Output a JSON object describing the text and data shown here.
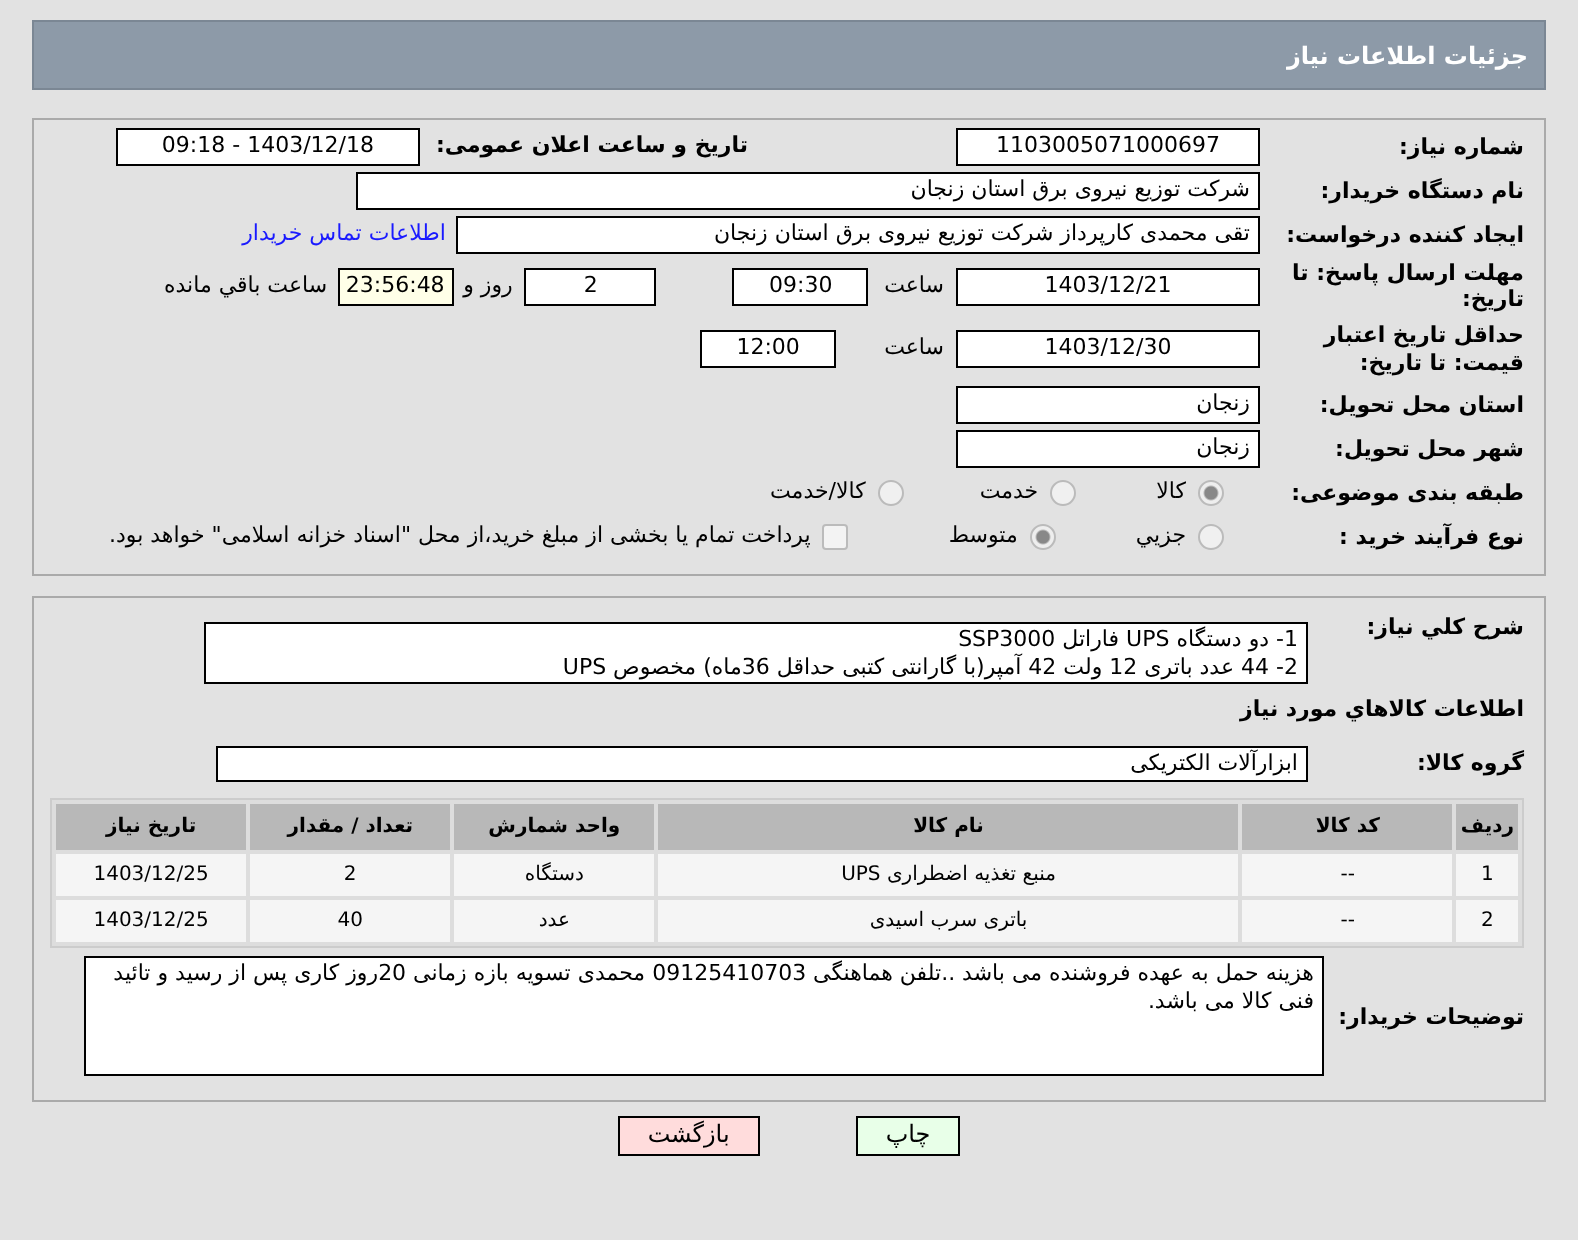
{
  "header": {
    "title": "جزئیات اطلاعات نیاز"
  },
  "fields": {
    "need_number": {
      "label": "شماره نیاز:",
      "value": "1103005071000697"
    },
    "announce": {
      "label": "تاریخ و ساعت اعلان عمومی:",
      "value": "1403/12/18 - 09:18"
    },
    "buyer": {
      "label": "نام دستگاه خریدار:",
      "value": "شرکت توزیع نیروی برق استان زنجان"
    },
    "creator": {
      "label": "ایجاد کننده درخواست:",
      "value": "تقی محمدی کارپرداز شرکت توزیع نیروی برق استان زنجان",
      "link": "اطلاعات تماس خریدار"
    },
    "deadline": {
      "label": "مهلت ارسال پاسخ: تا تاریخ:",
      "date": "1403/12/21",
      "time_label": "ساعت",
      "time": "09:30",
      "days": "2",
      "days_label": "روز و",
      "remaining": "23:56:48",
      "remaining_label": "ساعت باقي مانده"
    },
    "validity": {
      "label": "حداقل تاریخ اعتبار قیمت: تا تاریخ:",
      "date": "1403/12/30",
      "time_label": "ساعت",
      "time": "12:00"
    },
    "province": {
      "label": "استان محل تحویل:",
      "value": "زنجان"
    },
    "city": {
      "label": "شهر محل تحویل:",
      "value": "زنجان"
    }
  },
  "category": {
    "label": "طبقه بندی موضوعی:",
    "options": [
      {
        "label": "كالا",
        "selected": true
      },
      {
        "label": "خدمت",
        "selected": false
      },
      {
        "label": "كالا/خدمت",
        "selected": false
      }
    ]
  },
  "process": {
    "label": "نوع فرآیند خرید :",
    "options": [
      {
        "label": "جزیي",
        "selected": false
      },
      {
        "label": "متوسط",
        "selected": true
      }
    ],
    "payment_note": {
      "label": "پرداخت تمام یا بخشی از مبلغ خرید،از محل \"اسناد خزانه اسلامی\" خواهد بود.",
      "checked": false
    }
  },
  "summary": {
    "label": "شرح كلي نیاز:",
    "lines": [
      "1- دو دستگاه UPS فاراتل SSP3000",
      "2- 44 عدد باتری 12 ولت 42 آمپر(با گارانتی کتبی حداقل 36ماه) مخصوص UPS"
    ]
  },
  "goods_heading": "اطلاعات كالاهاي مورد نیاز",
  "goods_group": {
    "label": "گروه كالا:",
    "value": "ابزارآلات الکتریکی"
  },
  "table": {
    "columns": [
      "ردیف",
      "کد کالا",
      "نام کالا",
      "واحد شمارش",
      "تعداد / مقدار",
      "تاریخ نیاز"
    ],
    "rows": [
      [
        "1",
        "--",
        "منبع تغذیه اضطراری UPS",
        "دستگاه",
        "2",
        "1403/12/25"
      ],
      [
        "2",
        "--",
        "باتری سرب اسیدی",
        "عدد",
        "40",
        "1403/12/25"
      ]
    ]
  },
  "buyer_notes": {
    "label": "توضیحات خریدار:",
    "value": "هزینه حمل به عهده فروشنده می باشد ..تلفن هماهنگی 09125410703 محمدی تسویه بازه زمانی 20روز کاری پس از رسید و تائید فنی کالا می باشد."
  },
  "buttons": [
    {
      "kind": "print",
      "label": "چاپ"
    },
    {
      "kind": "back",
      "label": "بازگشت"
    }
  ]
}
